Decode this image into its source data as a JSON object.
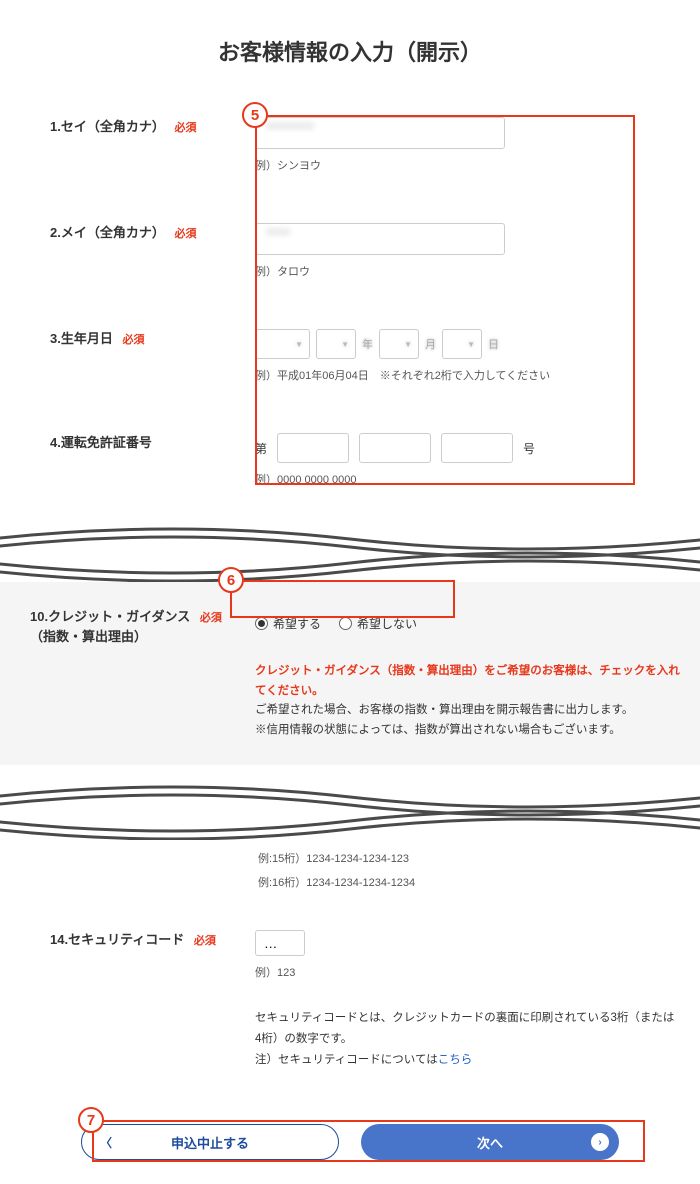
{
  "pageTitle": "お客様情報の入力（開示）",
  "callouts": {
    "c5": "5",
    "c6": "6",
    "c7": "7"
  },
  "fields": {
    "lastNameKana": {
      "label": "1.セイ（全角カナ）",
      "req": "必須",
      "example": "例）シンヨウ"
    },
    "firstNameKana": {
      "label": "2.メイ（全角カナ）",
      "req": "必須",
      "example": "例）タロウ"
    },
    "dob": {
      "label": "3.生年月日",
      "req": "必須",
      "example": "例）平成01年06月04日　※それぞれ2桁で入力してください",
      "unitYear": "年",
      "unitMonth": "月",
      "unitDay": "日"
    },
    "license": {
      "label": "4.運転免許証番号",
      "prefix": "第",
      "suffix": "号",
      "example": "例）0000 0000 0000"
    },
    "creditGuidance": {
      "label": "10.クレジット・ガイダンス",
      "sub": "（指数・算出理由）",
      "req": "必須",
      "opt1": "希望する",
      "opt2": "希望しない"
    },
    "securityCode": {
      "label": "14.セキュリティコード",
      "req": "必須",
      "value": "…",
      "example": "例）123"
    }
  },
  "guidanceNotice": {
    "red": "クレジット・ガイダンス（指数・算出理由）をご希望のお客様は、チェックを入れてください。",
    "line2": "ご希望された場合、お客様の指数・算出理由を開示報告書に出力します。",
    "line3": "※信用情報の状態によっては、指数が算出されない場合もございます。"
  },
  "cardExamples": {
    "ex15": "例:15桁）1234-1234-1234-123",
    "ex16": "例:16桁）1234-1234-1234-1234"
  },
  "secInfo": {
    "line1": "セキュリティコードとは、クレジットカードの裏面に印刷されている3桁（または4桁）の数字です。",
    "line2pre": "注）セキュリティコードについては",
    "link": "こちら"
  },
  "buttons": {
    "cancel": "申込中止する",
    "next": "次へ"
  }
}
